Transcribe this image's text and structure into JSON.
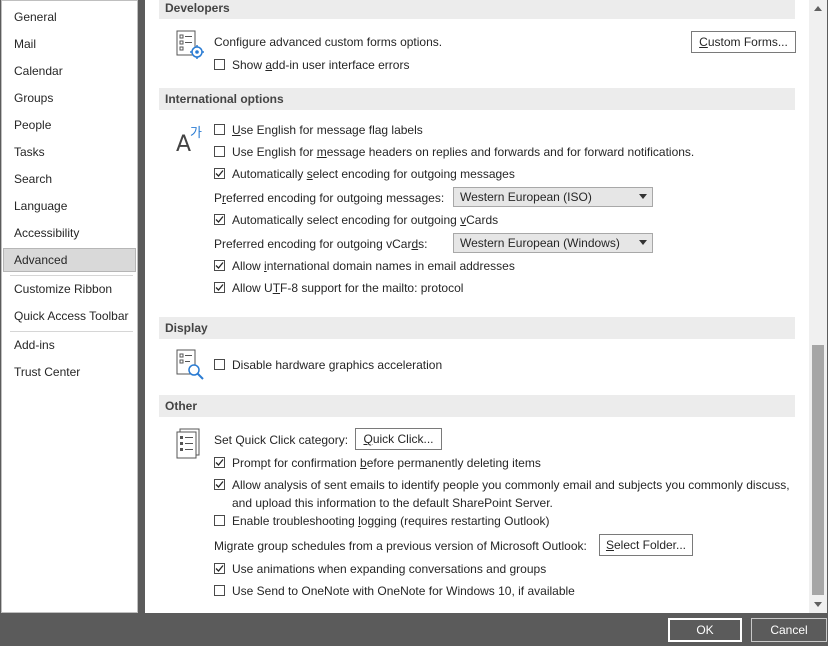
{
  "sidebar": {
    "items": [
      {
        "label": "General"
      },
      {
        "label": "Mail"
      },
      {
        "label": "Calendar"
      },
      {
        "label": "Groups"
      },
      {
        "label": "People"
      },
      {
        "label": "Tasks"
      },
      {
        "label": "Search"
      },
      {
        "label": "Language"
      },
      {
        "label": "Accessibility"
      },
      {
        "label": "Advanced"
      },
      {
        "label": "Customize Ribbon"
      },
      {
        "label": "Quick Access Toolbar"
      },
      {
        "label": "Add-ins"
      },
      {
        "label": "Trust Center"
      }
    ],
    "selected": "Advanced"
  },
  "developers": {
    "header": "Developers",
    "description": "Configure advanced custom forms options.",
    "custom_forms_button": {
      "pre": "",
      "key": "C",
      "post": "ustom Forms..."
    },
    "show_addin_errors": {
      "checked": false,
      "pre": "Show ",
      "key": "a",
      "post": "dd-in user interface errors"
    }
  },
  "international": {
    "header": "International options",
    "use_english_flag": {
      "checked": false,
      "pre": "",
      "key": "U",
      "post": "se English for message flag labels"
    },
    "use_english_headers": {
      "checked": false,
      "pre": "Use English for ",
      "key": "m",
      "post": "essage headers on replies and forwards and for forward notifications."
    },
    "auto_encoding_messages": {
      "checked": true,
      "pre": "Automatically ",
      "key": "s",
      "post": "elect encoding for outgoing messages"
    },
    "pref_encoding_messages": {
      "pre": "P",
      "key": "r",
      "post": "eferred encoding for outgoing messages:",
      "value": "Western European (ISO)"
    },
    "auto_encoding_vcards": {
      "checked": true,
      "pre": "Automatically select encoding for outgoing ",
      "key": "v",
      "post": "Cards"
    },
    "pref_encoding_vcards": {
      "pre": "Preferred encoding for outgoing vCar",
      "key": "d",
      "post": "s:",
      "value": "Western European (Windows)"
    },
    "allow_idn": {
      "checked": true,
      "pre": "Allow ",
      "key": "i",
      "post": "nternational domain names in email addresses"
    },
    "allow_utf8": {
      "checked": true,
      "pre": "Allow U",
      "key": "T",
      "post": "F-8 support for the mailto: protocol"
    }
  },
  "display": {
    "header": "Display",
    "disable_hw_accel": {
      "checked": false,
      "pre": "Disable hardware ",
      "key": "g",
      "post": "raphics acceleration"
    }
  },
  "other": {
    "header": "Other",
    "quick_click_label": "Set Quick Click category:",
    "quick_click_button": {
      "pre": "",
      "key": "Q",
      "post": "uick Click..."
    },
    "prompt_confirmation": {
      "checked": true,
      "pre": "Prompt for confirmation ",
      "key": "b",
      "post": "efore permanently deleting items"
    },
    "allow_analysis": {
      "checked": true,
      "pre": "Allow analysis of sent emails to identify people you commonly email and subjects you commonly discuss,",
      "line2": "and upload this information to the default SharePoint Server."
    },
    "enable_troubleshooting": {
      "checked": false,
      "pre": "Enable troubleshooting ",
      "key": "l",
      "post": "ogging (requires restarting Outlook)"
    },
    "migrate_label": "Migrate group schedules from a previous version of Microsoft Outlook:",
    "select_folder_button": {
      "pre": "",
      "key": "S",
      "post": "elect Folder..."
    },
    "use_animations": {
      "checked": true,
      "pre": "Use animations when expanding conversations and groups",
      "key": "",
      "post": ""
    },
    "use_send_onenote": {
      "checked": false,
      "pre": "Use Send to OneNote with OneNote for Windows 10, if available",
      "key": "",
      "post": ""
    }
  },
  "dialog": {
    "ok_label": "OK",
    "cancel_label": "Cancel"
  },
  "icons": {
    "section_developers": "form-gear-icon",
    "section_international": "language-icon",
    "section_display": "form-magnifier-icon",
    "section_other": "list-document-icon"
  }
}
